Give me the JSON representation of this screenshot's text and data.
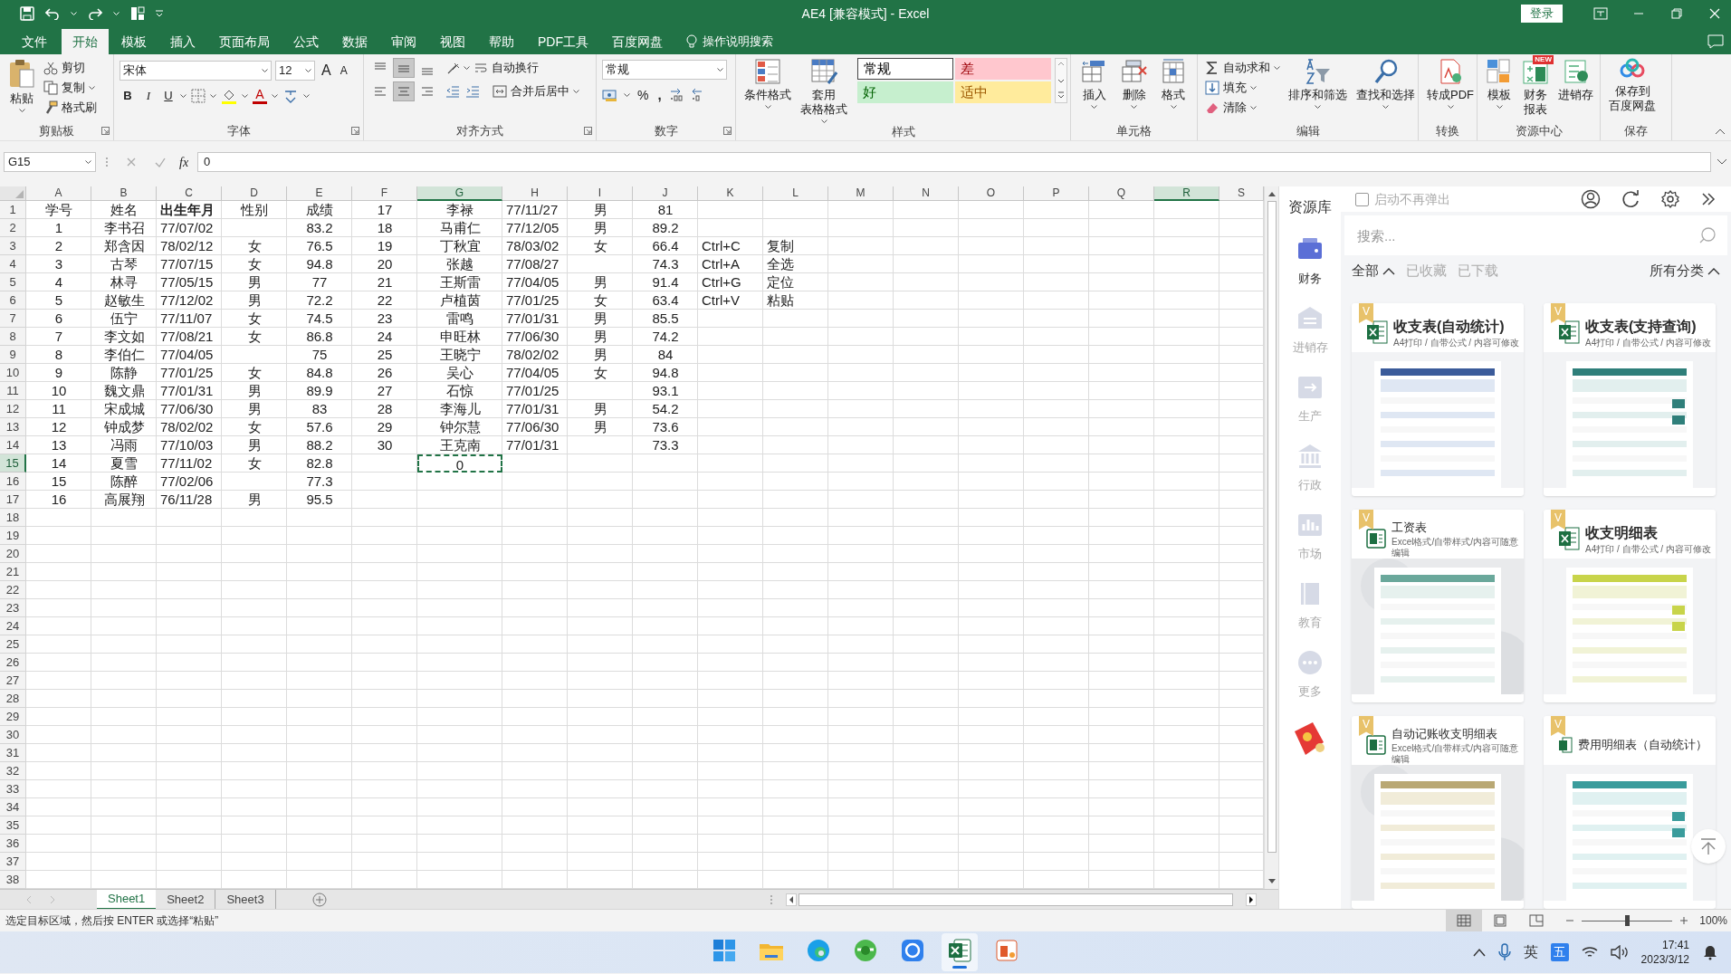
{
  "window": {
    "title": "AE4  [兼容模式]  -  Excel",
    "login_button": "登录"
  },
  "ribbon_tabs": [
    {
      "label": "文件",
      "selected": false
    },
    {
      "label": "开始",
      "selected": true
    },
    {
      "label": "模板",
      "selected": false
    },
    {
      "label": "插入",
      "selected": false
    },
    {
      "label": "页面布局",
      "selected": false
    },
    {
      "label": "公式",
      "selected": false
    },
    {
      "label": "数据",
      "selected": false
    },
    {
      "label": "审阅",
      "selected": false
    },
    {
      "label": "视图",
      "selected": false
    },
    {
      "label": "帮助",
      "selected": false
    },
    {
      "label": "PDF工具",
      "selected": false
    },
    {
      "label": "百度网盘",
      "selected": false
    }
  ],
  "tell_me": "操作说明搜索",
  "ribbon_groups": [
    {
      "kind": "clipboard",
      "label": "剪贴板",
      "paste": "粘贴",
      "cut": "剪切",
      "copy": "复制",
      "format_painter": "格式刷"
    },
    {
      "kind": "font",
      "label": "字体",
      "font_name": "宋体",
      "font_size": "12",
      "grow": "A",
      "shrink": "A",
      "bold": "B",
      "italic": "I",
      "underline": "U",
      "font_color": "A"
    },
    {
      "kind": "alignment",
      "label": "对齐方式",
      "vertical": [
        {
          "selected": false
        },
        {
          "selected": true
        },
        {
          "selected": false
        }
      ],
      "horizontal": [
        {
          "selected": false
        },
        {
          "selected": true
        },
        {
          "selected": false
        }
      ],
      "wrap": "自动换行",
      "merge": "合并后居中"
    },
    {
      "kind": "number",
      "label": "数字",
      "format": "常规",
      "percent": "%",
      "comma": ","
    },
    {
      "kind": "styles",
      "label": "样式",
      "conditional": "条件格式",
      "table_format": [
        "套用",
        "表格格式"
      ],
      "styles": [
        {
          "label": "常规",
          "color": "#ffffff"
        },
        {
          "label": "差",
          "color": "#ffc7ce"
        },
        {
          "label": "好",
          "color": "#c6efce"
        },
        {
          "label": "适中",
          "color": "#ffeb9c"
        }
      ]
    },
    {
      "kind": "cells",
      "label": "单元格",
      "buttons": [
        "插入",
        "删除",
        "格式"
      ]
    },
    {
      "kind": "editing",
      "label": "编辑",
      "autosum": "自动求和",
      "fill": "填充",
      "clear": "清除",
      "sort": "排序和筛选",
      "find": "查找和选择"
    },
    {
      "kind": "convert",
      "label": "转换",
      "pdf": "转成PDF"
    },
    {
      "kind": "resources",
      "label": "资源中心",
      "template": "模板",
      "report": [
        "财务",
        "报表"
      ],
      "badge": "NEW",
      "inventory": "进销存"
    },
    {
      "kind": "save",
      "label": "保存",
      "save": [
        "保存到",
        "百度网盘"
      ]
    }
  ],
  "formula_bar": {
    "name_box": "G15",
    "function_label": "fx",
    "formula": "0"
  },
  "spreadsheet": {
    "columns": [
      {
        "label": "A",
        "selected": false
      },
      {
        "label": "B",
        "selected": false
      },
      {
        "label": "C",
        "selected": false
      },
      {
        "label": "D",
        "selected": false
      },
      {
        "label": "E",
        "selected": false
      },
      {
        "label": "F",
        "selected": false
      },
      {
        "label": "G",
        "selected": true
      },
      {
        "label": "H",
        "selected": false
      },
      {
        "label": "I",
        "selected": false
      },
      {
        "label": "J",
        "selected": false
      },
      {
        "label": "K",
        "selected": false
      },
      {
        "label": "L",
        "selected": false
      },
      {
        "label": "M",
        "selected": false
      },
      {
        "label": "N",
        "selected": false
      },
      {
        "label": "O",
        "selected": false
      },
      {
        "label": "P",
        "selected": false
      },
      {
        "label": "Q",
        "selected": false
      },
      {
        "label": "R",
        "selected": true
      },
      {
        "label": "S",
        "selected": false
      }
    ],
    "rows": [
      {
        "label": "1",
        "selected": false,
        "cells": {
          "A": "学号",
          "B": "姓名",
          "C": {
            "text": "出生年月",
            "bold": true
          },
          "D": "性别",
          "E": "成绩",
          "F": "17",
          "G": "李禄",
          "H": "77/11/27",
          "I": "男",
          "J": "81"
        }
      },
      {
        "label": "2",
        "selected": false,
        "cells": {
          "A": "1",
          "B": "李书召",
          "C": "77/07/02",
          "E": "83.2",
          "F": "18",
          "G": "马甫仁",
          "H": "77/12/05",
          "I": "男",
          "J": "89.2"
        }
      },
      {
        "label": "3",
        "selected": false,
        "cells": {
          "A": "2",
          "B": "郑含因",
          "C": "78/02/12",
          "D": "女",
          "E": "76.5",
          "F": "19",
          "G": "丁秋宜",
          "H": "78/03/02",
          "I": "女",
          "J": "66.4",
          "K": "Ctrl+C",
          "L": "复制"
        }
      },
      {
        "label": "4",
        "selected": false,
        "cells": {
          "A": "3",
          "B": "古琴",
          "C": "77/07/15",
          "D": "女",
          "E": "94.8",
          "F": "20",
          "G": "张越",
          "H": "77/08/27",
          "J": "74.3",
          "K": "Ctrl+A",
          "L": "全选"
        }
      },
      {
        "label": "5",
        "selected": false,
        "cells": {
          "A": "4",
          "B": "林寻",
          "C": "77/05/15",
          "D": "男",
          "E": "77",
          "F": "21",
          "G": "王斯雷",
          "H": "77/04/05",
          "I": "男",
          "J": "91.4",
          "K": "Ctrl+G",
          "L": "定位"
        }
      },
      {
        "label": "6",
        "selected": false,
        "cells": {
          "A": "5",
          "B": "赵敏生",
          "C": "77/12/02",
          "D": "男",
          "E": "72.2",
          "F": "22",
          "G": "卢植茵",
          "H": "77/01/25",
          "I": "女",
          "J": "63.4",
          "K": "Ctrl+V",
          "L": "粘贴"
        }
      },
      {
        "label": "7",
        "selected": false,
        "cells": {
          "A": "6",
          "B": "伍宁",
          "C": "77/11/07",
          "D": "女",
          "E": "74.5",
          "F": "23",
          "G": "雷鸣",
          "H": "77/01/31",
          "I": "男",
          "J": "85.5"
        }
      },
      {
        "label": "8",
        "selected": false,
        "cells": {
          "A": "7",
          "B": "李文如",
          "C": "77/08/21",
          "D": "女",
          "E": "86.8",
          "F": "24",
          "G": "申旺林",
          "H": "77/06/30",
          "I": "男",
          "J": "74.2"
        }
      },
      {
        "label": "9",
        "selected": false,
        "cells": {
          "A": "8",
          "B": "李伯仁",
          "C": "77/04/05",
          "E": "75",
          "F": "25",
          "G": "王晓宁",
          "H": "78/02/02",
          "I": "男",
          "J": "84"
        }
      },
      {
        "label": "10",
        "selected": false,
        "cells": {
          "A": "9",
          "B": "陈静",
          "C": "77/01/25",
          "D": "女",
          "E": "84.8",
          "F": "26",
          "G": "吴心",
          "H": "77/04/05",
          "I": "女",
          "J": "94.8"
        }
      },
      {
        "label": "11",
        "selected": false,
        "cells": {
          "A": "10",
          "B": "魏文鼎",
          "C": "77/01/31",
          "D": "男",
          "E": "89.9",
          "F": "27",
          "G": "石惊",
          "H": "77/01/25",
          "J": "93.1"
        }
      },
      {
        "label": "12",
        "selected": false,
        "cells": {
          "A": "11",
          "B": "宋成城",
          "C": "77/06/30",
          "D": "男",
          "E": "83",
          "F": "28",
          "G": "李海儿",
          "H": "77/01/31",
          "I": "男",
          "J": "54.2"
        }
      },
      {
        "label": "13",
        "selected": false,
        "cells": {
          "A": "12",
          "B": "钟成梦",
          "C": "78/02/02",
          "D": "女",
          "E": "57.6",
          "F": "29",
          "G": "钟尔慧",
          "H": "77/06/30",
          "I": "男",
          "J": "73.6"
        }
      },
      {
        "label": "14",
        "selected": false,
        "cells": {
          "A": "13",
          "B": "冯雨",
          "C": "77/10/03",
          "D": "男",
          "E": "88.2",
          "F": "30",
          "G": "王克南",
          "H": "77/01/31",
          "J": "73.3"
        }
      },
      {
        "label": "15",
        "selected": true,
        "cells": {
          "A": "14",
          "B": "夏雪",
          "C": "77/11/02",
          "D": "女",
          "E": "82.8",
          "G": {
            "text": "0",
            "active": true
          }
        }
      },
      {
        "label": "16",
        "selected": false,
        "cells": {
          "A": "15",
          "B": "陈醉",
          "C": "77/02/06",
          "E": "77.3"
        }
      },
      {
        "label": "17",
        "selected": false,
        "cells": {
          "A": "16",
          "B": "高展翔",
          "C": "76/11/28",
          "D": "男",
          "E": "95.5"
        }
      },
      {
        "label": "18",
        "selected": false
      },
      {
        "label": "19",
        "selected": false
      },
      {
        "label": "20",
        "selected": false
      },
      {
        "label": "21",
        "selected": false
      },
      {
        "label": "22",
        "selected": false
      },
      {
        "label": "23",
        "selected": false
      },
      {
        "label": "24",
        "selected": false
      },
      {
        "label": "25",
        "selected": false
      },
      {
        "label": "26",
        "selected": false
      },
      {
        "label": "27",
        "selected": false
      },
      {
        "label": "28",
        "selected": false
      },
      {
        "label": "29",
        "selected": false
      },
      {
        "label": "30",
        "selected": false
      },
      {
        "label": "31",
        "selected": false
      },
      {
        "label": "32",
        "selected": false
      },
      {
        "label": "33",
        "selected": false
      },
      {
        "label": "34",
        "selected": false
      },
      {
        "label": "35",
        "selected": false
      },
      {
        "label": "36",
        "selected": false
      },
      {
        "label": "37",
        "selected": false
      },
      {
        "label": "38",
        "selected": false
      }
    ]
  },
  "sheet_tabs": [
    {
      "label": "Sheet1",
      "selected": true
    },
    {
      "label": "Sheet2",
      "selected": false
    },
    {
      "label": "Sheet3",
      "selected": false
    }
  ],
  "resource_pane": {
    "title": "资源库",
    "dont_show_again": {
      "label": "启动不再弹出",
      "checked": false
    },
    "search": {
      "placeholder": "搜索..."
    },
    "filters": [
      {
        "label": "全部",
        "selected": true
      },
      {
        "label": "已收藏",
        "selected": false
      },
      {
        "label": "已下载",
        "selected": false
      }
    ],
    "category": "所有分类",
    "nav": [
      {
        "label": "财务",
        "selected": true
      },
      {
        "label": "进销存",
        "selected": false
      },
      {
        "label": "生产",
        "selected": false
      },
      {
        "label": "行政",
        "selected": false
      },
      {
        "label": "市场",
        "selected": false
      },
      {
        "label": "教育",
        "selected": false
      },
      {
        "label": "更多",
        "selected": false
      }
    ],
    "templates": [
      {
        "kind": "large",
        "badge": "V",
        "title": "收支表(自动统计)",
        "subtitle": "A4打印 / 自带公式 / 内容可修改"
      },
      {
        "kind": "large",
        "badge": "V",
        "title": "收支表(支持查询)",
        "subtitle": "A4打印 / 自带公式 / 内容可修改"
      },
      {
        "kind": "compact",
        "badge": "V",
        "title": "工资表",
        "subtitle": "Excel格式/自带样式/内容可随意编辑"
      },
      {
        "kind": "large",
        "badge": "V",
        "title": "收支明细表",
        "subtitle": "A4打印 / 自带公式 / 内容可修改"
      },
      {
        "kind": "compact",
        "badge": "V",
        "title": "自动记账收支明细表",
        "subtitle": "Excel格式/自带样式/内容可随意编辑"
      },
      {
        "kind": "plain",
        "badge": "V",
        "title": "费用明细表（自动统计）"
      }
    ]
  },
  "status_bar": {
    "message": "选定目标区域，然后按 ENTER 或选择“粘贴”",
    "views": [
      {
        "selected": true
      },
      {
        "selected": false
      },
      {
        "selected": false
      }
    ],
    "zoom": {
      "level": 0.5
    },
    "zoom_label": "100%"
  },
  "taskbar": {
    "apps": [
      {
        "selected": false
      },
      {
        "selected": false
      },
      {
        "selected": false
      },
      {
        "selected": false
      },
      {
        "selected": false
      },
      {
        "selected": true
      },
      {
        "selected": false
      }
    ],
    "language": "英",
    "input_method": "五",
    "time": "17:41",
    "date": "2023/3/12"
  }
}
